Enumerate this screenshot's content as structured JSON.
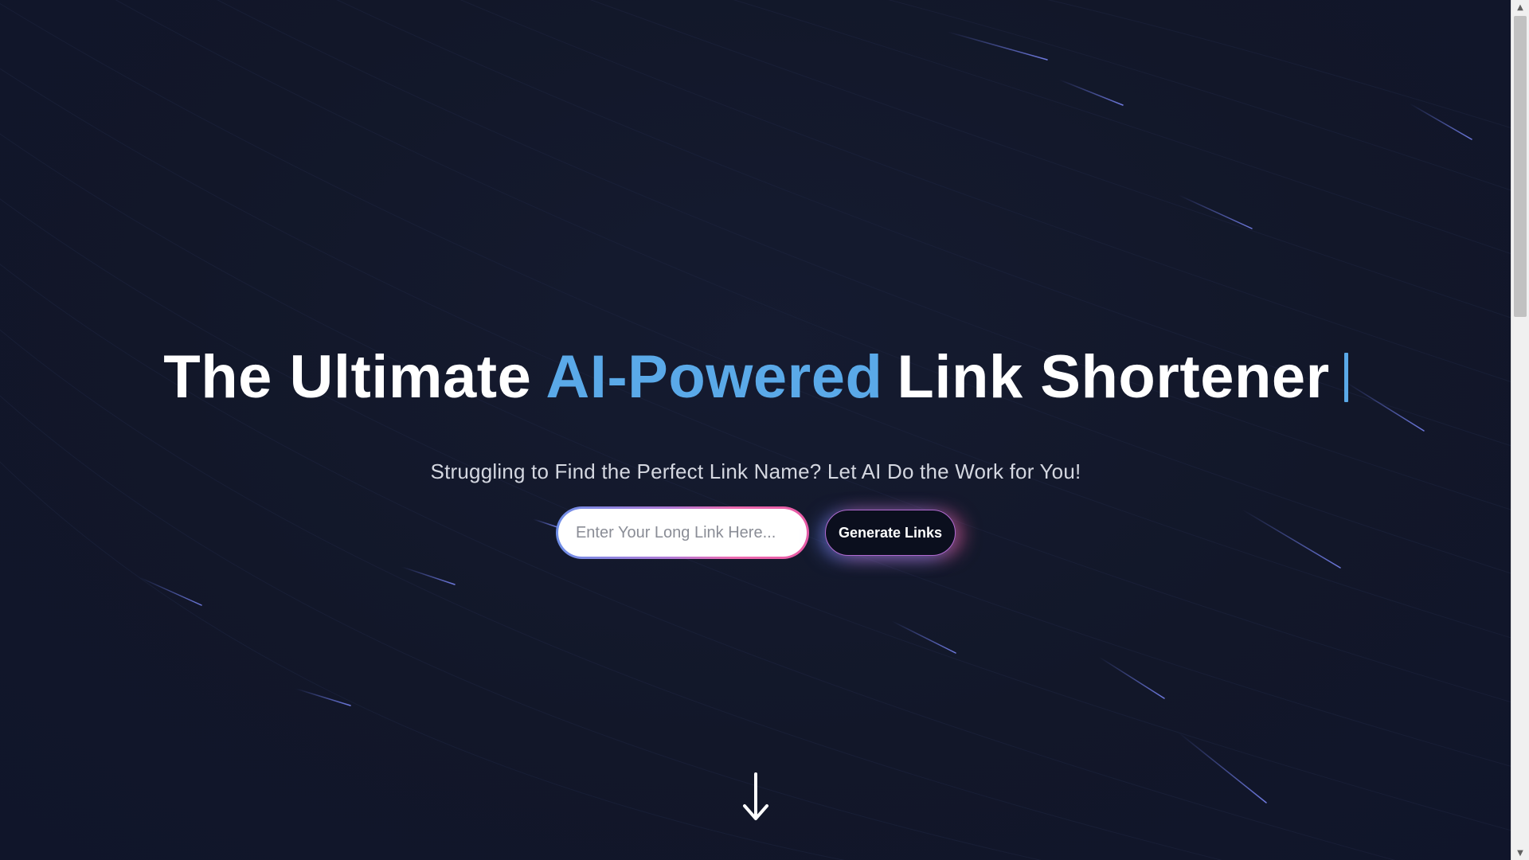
{
  "hero": {
    "title_part1": "The Ultimate",
    "title_accent": "AI-Powered",
    "title_part2": "Link Shortener",
    "subtitle": "Struggling to Find the Perfect Link Name? Let AI Do the Work for You!"
  },
  "form": {
    "input_placeholder": "Enter Your Long Link Here...",
    "input_value": "",
    "button_label": "Generate Links"
  },
  "icons": {
    "scroll_arrow": "arrow-down-icon",
    "scroll_up": "▲",
    "scroll_down": "▼"
  },
  "colors": {
    "background": "#121729",
    "accent": "#5aa9e8",
    "button_bg": "#0b0f1e",
    "gradient_blue": "#6f8fe8",
    "gradient_pink": "#ec6bb0"
  }
}
